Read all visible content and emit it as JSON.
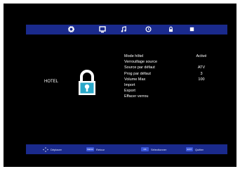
{
  "colors": {
    "bar": "#1a2a8c",
    "screen": "#000000",
    "text": "#ffffff"
  },
  "tabs": [
    {
      "icon": "gear-icon"
    },
    {
      "icon": "monitor-icon"
    },
    {
      "icon": "music-note-icon"
    },
    {
      "icon": "clock-icon"
    },
    {
      "icon": "lock-icon"
    },
    {
      "icon": "square-icon"
    }
  ],
  "hotel_label": "HOTEL",
  "menu": {
    "items": [
      {
        "label": "Mode hôtel",
        "value": "Activé"
      },
      {
        "label": "Verrouillage source",
        "value": ""
      },
      {
        "label": "Source par défaut",
        "value": "ATV"
      },
      {
        "label": "Prog par défaut",
        "value": "3"
      },
      {
        "label": "Volume Max",
        "value": "100"
      },
      {
        "label": "Import",
        "value": ""
      },
      {
        "label": "Export",
        "value": ""
      },
      {
        "label": "Effacer verrou",
        "value": ""
      }
    ]
  },
  "footer": {
    "move": {
      "icon": "dpad-icon",
      "label": "Déplacer"
    },
    "back": {
      "key": "MENU",
      "label": "Retour"
    },
    "select": {
      "key": "OK",
      "label": "Sélectionner"
    },
    "exit": {
      "key": "EXIT",
      "label": "Quitter"
    }
  }
}
